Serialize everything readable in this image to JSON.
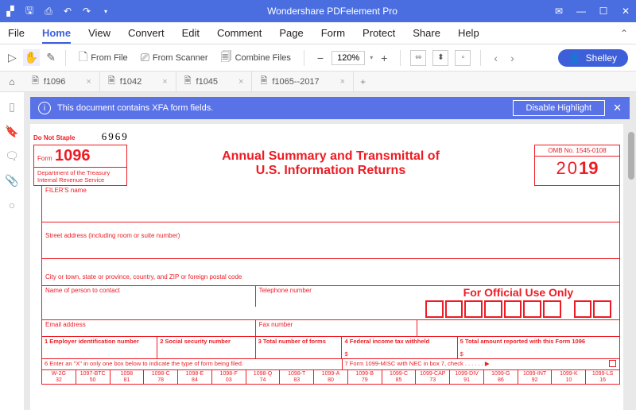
{
  "titlebar": {
    "title": "Wondershare PDFelement Pro"
  },
  "menu": {
    "file": "File",
    "home": "Home",
    "view": "View",
    "convert": "Convert",
    "edit": "Edit",
    "comment": "Comment",
    "page": "Page",
    "form": "Form",
    "protect": "Protect",
    "share": "Share",
    "help": "Help"
  },
  "toolbar": {
    "from_file": "From File",
    "from_scanner": "From Scanner",
    "combine": "Combine Files",
    "zoom": "120%",
    "user": "Shelley"
  },
  "tabs": [
    {
      "name": "f1096"
    },
    {
      "name": "f1042"
    },
    {
      "name": "f1045"
    },
    {
      "name": "f1065--2017"
    }
  ],
  "infobar": {
    "msg": "This document contains XFA form fields.",
    "btn": "Disable Highlight"
  },
  "form": {
    "do_not_staple": "Do Not Staple",
    "handwritten": "6969",
    "form_label": "Form",
    "form_number": "1096",
    "dept1": "Department of the Treasury",
    "dept2": "Internal Revenue Service",
    "title1": "Annual Summary and Transmittal of",
    "title2": "U.S. Information Returns",
    "omb": "OMB No. 1545-0108",
    "year_prefix": "20",
    "year_suffix": "19",
    "filer_name": "FILER'S name",
    "street": "Street address (including room or suite number)",
    "city": "City or town, state or province, country, and ZIP or foreign postal code",
    "contact": "Name of person to contact",
    "telephone": "Telephone number",
    "email": "Email address",
    "fax": "Fax number",
    "official": "For Official Use Only",
    "c1": "1 Employer identification number",
    "c2": "2 Social security number",
    "c3": "3 Total number of forms",
    "c4": "4 Federal income tax withheld",
    "c5": "5 Total amount reported with this Form 1096",
    "c6": "6 Enter an \"X\" in only one box below to indicate the type of form being filed.",
    "c7": "7 Form 1099-MISC with NEC in box 7, check . . . . . .   ▶",
    "dollar": "$",
    "boxes": [
      {
        "t": "W-2G",
        "b": "32"
      },
      {
        "t": "1097-BTC",
        "b": "50"
      },
      {
        "t": "1098",
        "b": "81"
      },
      {
        "t": "1098-C",
        "b": "78"
      },
      {
        "t": "1098-E",
        "b": "84"
      },
      {
        "t": "1098-F",
        "b": "03"
      },
      {
        "t": "1098-Q",
        "b": "74"
      },
      {
        "t": "1098-T",
        "b": "83"
      },
      {
        "t": "1099-A",
        "b": "80"
      },
      {
        "t": "1099-B",
        "b": "79"
      },
      {
        "t": "1099-C",
        "b": "85"
      },
      {
        "t": "1099-CAP",
        "b": "73"
      },
      {
        "t": "1099-DIV",
        "b": "91"
      },
      {
        "t": "1099-G",
        "b": "86"
      },
      {
        "t": "1099-INT",
        "b": "92"
      },
      {
        "t": "1099-K",
        "b": "10"
      },
      {
        "t": "1099-LS",
        "b": "16"
      }
    ]
  }
}
